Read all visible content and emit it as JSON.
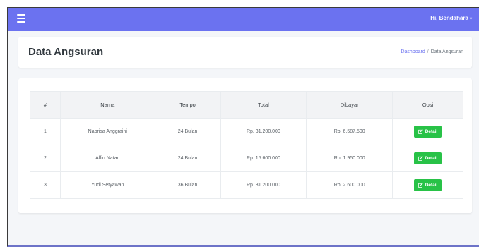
{
  "topbar": {
    "menu_icon": "hamburger-icon",
    "user_greeting": "Hi, Bendahara",
    "accent_color": "#6b72f0"
  },
  "header": {
    "title": "Data Angsuran",
    "breadcrumb": {
      "home": "Dashboard",
      "separator": "/",
      "current": "Data Angsuran"
    }
  },
  "table": {
    "columns": [
      "#",
      "Nama",
      "Tempo",
      "Total",
      "Dibayar",
      "Opsi"
    ],
    "rows": [
      {
        "no": "1",
        "nama": "Naprisa Anggraini",
        "tempo": "24 Bulan",
        "total": "Rp. 31.200.000",
        "dibayar": "Rp. 6.587.500",
        "action": "Detail"
      },
      {
        "no": "2",
        "nama": "Alfin Natan",
        "tempo": "24 Bulan",
        "total": "Rp. 15.600.000",
        "dibayar": "Rp. 1.950.000",
        "action": "Detail"
      },
      {
        "no": "3",
        "nama": "Yudi Setyawan",
        "tempo": "36 Bulan",
        "total": "Rp. 31.200.000",
        "dibayar": "Rp. 2.600.000",
        "action": "Detail"
      }
    ],
    "action_icon": "edit-icon",
    "action_color": "#28c247"
  }
}
